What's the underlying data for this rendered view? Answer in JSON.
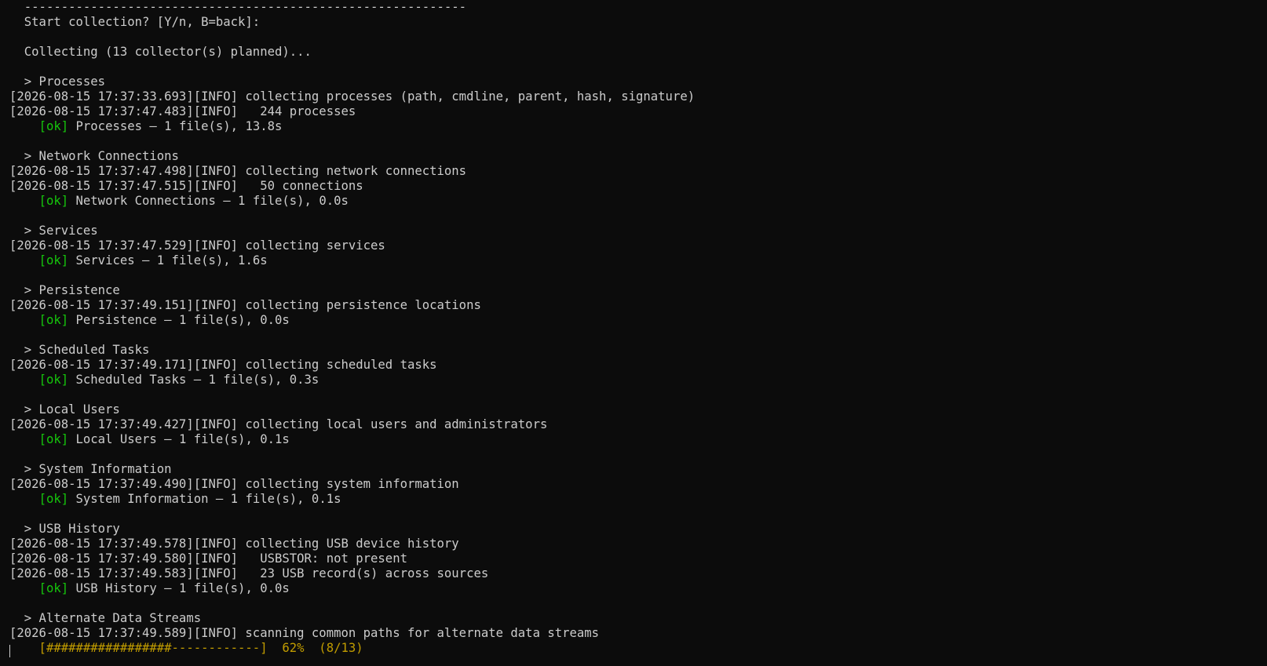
{
  "terminal": {
    "lines": [
      {
        "kind": "text",
        "text": "  ------------------------------------------------------------"
      },
      {
        "kind": "text",
        "text": "  Start collection? [Y/n, B=back]:"
      },
      {
        "kind": "blank",
        "text": ""
      },
      {
        "kind": "text",
        "text": "  Collecting (13 collector(s) planned)..."
      },
      {
        "kind": "blank",
        "text": ""
      },
      {
        "kind": "section",
        "text": "  > Processes"
      },
      {
        "kind": "log",
        "text": "[2026-08-15 17:37:33.693][INFO] collecting processes (path, cmdline, parent, hash, signature)"
      },
      {
        "kind": "log",
        "text": "[2026-08-15 17:37:47.483][INFO]   244 processes"
      },
      {
        "kind": "ok",
        "indent": "    ",
        "tag": "[ok]",
        "text": " Processes – 1 file(s), 13.8s"
      },
      {
        "kind": "blank",
        "text": ""
      },
      {
        "kind": "section",
        "text": "  > Network Connections"
      },
      {
        "kind": "log",
        "text": "[2026-08-15 17:37:47.498][INFO] collecting network connections"
      },
      {
        "kind": "log",
        "text": "[2026-08-15 17:37:47.515][INFO]   50 connections"
      },
      {
        "kind": "ok",
        "indent": "    ",
        "tag": "[ok]",
        "text": " Network Connections – 1 file(s), 0.0s"
      },
      {
        "kind": "blank",
        "text": ""
      },
      {
        "kind": "section",
        "text": "  > Services"
      },
      {
        "kind": "log",
        "text": "[2026-08-15 17:37:47.529][INFO] collecting services"
      },
      {
        "kind": "ok",
        "indent": "    ",
        "tag": "[ok]",
        "text": " Services – 1 file(s), 1.6s"
      },
      {
        "kind": "blank",
        "text": ""
      },
      {
        "kind": "section",
        "text": "  > Persistence"
      },
      {
        "kind": "log",
        "text": "[2026-08-15 17:37:49.151][INFO] collecting persistence locations"
      },
      {
        "kind": "ok",
        "indent": "    ",
        "tag": "[ok]",
        "text": " Persistence – 1 file(s), 0.0s"
      },
      {
        "kind": "blank",
        "text": ""
      },
      {
        "kind": "section",
        "text": "  > Scheduled Tasks"
      },
      {
        "kind": "log",
        "text": "[2026-08-15 17:37:49.171][INFO] collecting scheduled tasks"
      },
      {
        "kind": "ok",
        "indent": "    ",
        "tag": "[ok]",
        "text": " Scheduled Tasks – 1 file(s), 0.3s"
      },
      {
        "kind": "blank",
        "text": ""
      },
      {
        "kind": "section",
        "text": "  > Local Users"
      },
      {
        "kind": "log",
        "text": "[2026-08-15 17:37:49.427][INFO] collecting local users and administrators"
      },
      {
        "kind": "ok",
        "indent": "    ",
        "tag": "[ok]",
        "text": " Local Users – 1 file(s), 0.1s"
      },
      {
        "kind": "blank",
        "text": ""
      },
      {
        "kind": "section",
        "text": "  > System Information"
      },
      {
        "kind": "log",
        "text": "[2026-08-15 17:37:49.490][INFO] collecting system information"
      },
      {
        "kind": "ok",
        "indent": "    ",
        "tag": "[ok]",
        "text": " System Information – 1 file(s), 0.1s"
      },
      {
        "kind": "blank",
        "text": ""
      },
      {
        "kind": "section",
        "text": "  > USB History"
      },
      {
        "kind": "log",
        "text": "[2026-08-15 17:37:49.578][INFO] collecting USB device history"
      },
      {
        "kind": "log",
        "text": "[2026-08-15 17:37:49.580][INFO]   USBSTOR: not present"
      },
      {
        "kind": "log",
        "text": "[2026-08-15 17:37:49.583][INFO]   23 USB record(s) across sources"
      },
      {
        "kind": "ok",
        "indent": "    ",
        "tag": "[ok]",
        "text": " USB History – 1 file(s), 0.0s"
      },
      {
        "kind": "blank",
        "text": ""
      },
      {
        "kind": "section",
        "text": "  > Alternate Data Streams"
      },
      {
        "kind": "log",
        "text": "[2026-08-15 17:37:49.589][INFO] scanning common paths for alternate data streams"
      },
      {
        "kind": "progress",
        "text": "    [#################------------]  62%  (8/13)"
      }
    ],
    "progress": {
      "percent": 62,
      "done": 8,
      "total": 13
    },
    "colors": {
      "background": "#0c0c0c",
      "foreground": "#cccccc",
      "ok": "#16c60c",
      "progress": "#c19c00"
    }
  }
}
